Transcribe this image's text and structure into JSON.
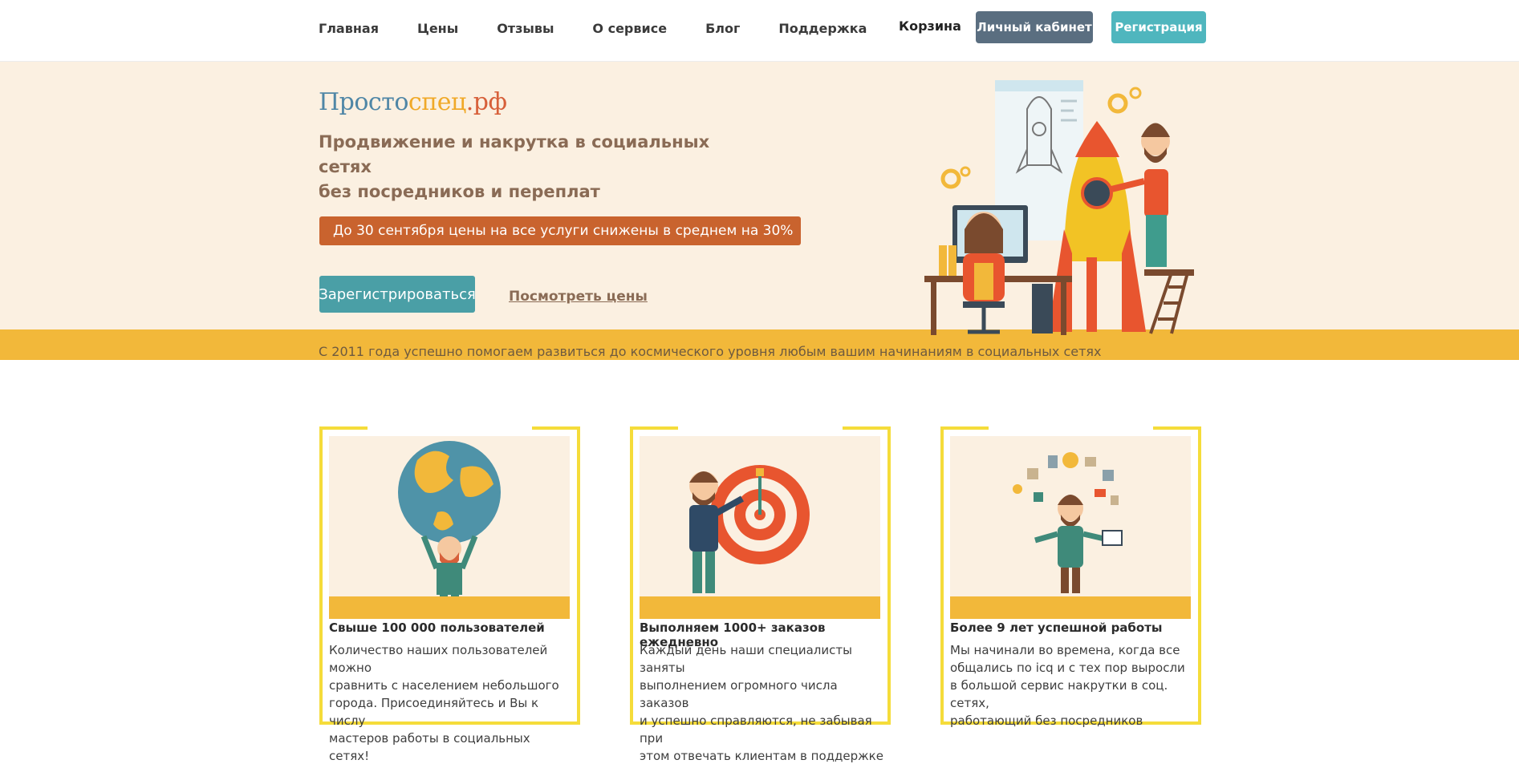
{
  "nav": {
    "items": [
      "Главная",
      "Цены",
      "Отзывы",
      "О сервисе",
      "Блог",
      "Поддержка"
    ],
    "cart": "Корзина",
    "cabinet": "Личный кабинет",
    "register": "Регистрация"
  },
  "hero": {
    "brand_part1": "Просто",
    "brand_part2": "спец",
    "brand_part3": ".рф",
    "tagline_line1": "Продвижение и накрутка в социальных сетях",
    "tagline_line2": "без посредников и переплат",
    "promo": "До 30 сентября цены на все услуги снижены в среднем на 30%",
    "cta": "Зарегистрироваться",
    "prices_link": "Посмотреть цены",
    "since": "С 2011 года успешно помогаем развиться до космического уровня любым вашим начинаниям в социальных сетях"
  },
  "features": [
    {
      "icon": "globe-man-icon",
      "title": "Свыше 100 000 пользователей",
      "text": "Количество наших пользователей можно\nсравнить с населением небольшого\nгорода. Присоединяйтесь и Вы к числу\nмастеров работы в социальных сетях!"
    },
    {
      "icon": "target-man-icon",
      "title": "Выполняем 1000+ заказов ежедневно",
      "text": "Каждый день наши специалисты заняты\nвыполнением огромного числа заказов\nи успешно справляются, не забывая при\nэтом отвечать клиентам в поддержке"
    },
    {
      "icon": "ideas-man-icon",
      "title": "Более 9 лет успешной работы",
      "text": "Мы начинали во времена, когда все\nобщались по icq и с тех пор выросли\nв большой сервис накрутки в соц. сетях,\nработающий без посредников"
    }
  ],
  "colors": {
    "accent_yellow": "#f2b83a",
    "hero_bg": "#fbf0e1",
    "promo_orange": "#c9632e",
    "teal": "#4a9fa6",
    "cabinet_button": "#5a6e80",
    "card_frame": "#f5dc3a"
  }
}
